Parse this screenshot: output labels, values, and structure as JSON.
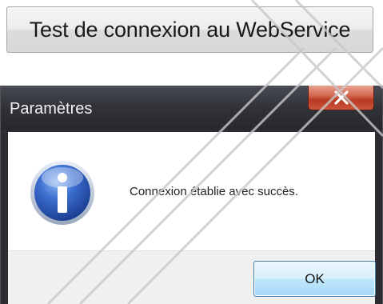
{
  "top_button": {
    "label": "Test de connexion au WebService"
  },
  "dialog": {
    "title": "Paramètres",
    "close_glyph": "x",
    "message": "Connexion établie avec succès.",
    "icon": "information-icon",
    "ok_label": "OK"
  },
  "colors": {
    "titlebar": "#2b2d33",
    "close_button": "#c9553a",
    "info_icon": "#2f62c4",
    "ok_border": "#3c7fb1"
  }
}
